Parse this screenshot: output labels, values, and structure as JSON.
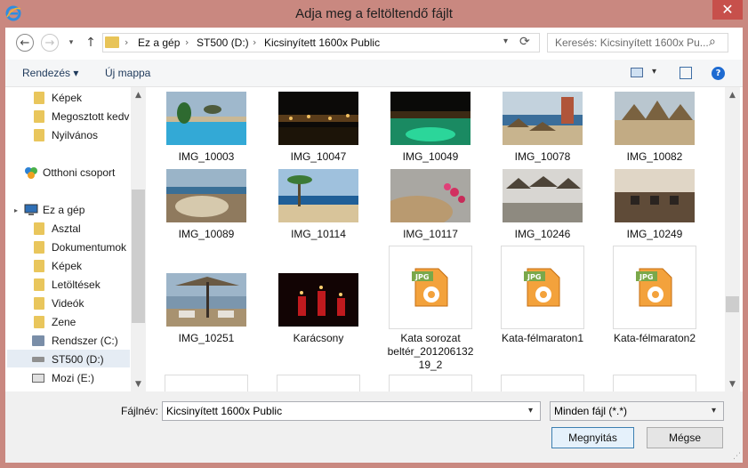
{
  "window": {
    "title": "Adja meg a feltöltendő fájlt",
    "close_glyph": "✕",
    "app_icon": "ie-icon"
  },
  "address": {
    "crumbs": [
      "Ez a gép",
      "ST500 (D:)",
      "Kicsinyített 1600x Public"
    ],
    "separator": "›",
    "search_placeholder": "Keresés: Kicsinyített 1600x Pu..."
  },
  "toolbar": {
    "organize": "Rendezés ▾",
    "new_folder": "Új mappa"
  },
  "nav": {
    "items": [
      {
        "label": "Képek",
        "icon": "folder-icon"
      },
      {
        "label": "Megosztott kedv",
        "icon": "folder-icon"
      },
      {
        "label": "Nyilvános",
        "icon": "folder-icon"
      },
      {
        "label": "Otthoni csoport",
        "icon": "homegroup-icon"
      },
      {
        "label": "Ez a gép",
        "icon": "computer-icon"
      },
      {
        "label": "Asztal",
        "icon": "desktop-folder-icon"
      },
      {
        "label": "Dokumentumok",
        "icon": "documents-folder-icon"
      },
      {
        "label": "Képek",
        "icon": "pictures-folder-icon"
      },
      {
        "label": "Letöltések",
        "icon": "downloads-folder-icon"
      },
      {
        "label": "Videók",
        "icon": "videos-folder-icon"
      },
      {
        "label": "Zene",
        "icon": "music-folder-icon"
      },
      {
        "label": "Rendszer (C:)",
        "icon": "system-drive-icon"
      },
      {
        "label": "ST500 (D:)",
        "icon": "drive-icon"
      },
      {
        "label": "Mozi (E:)",
        "icon": "drive-icon"
      }
    ]
  },
  "files": [
    {
      "name": "IMG_10003"
    },
    {
      "name": "IMG_10047"
    },
    {
      "name": "IMG_10049"
    },
    {
      "name": "IMG_10078"
    },
    {
      "name": "IMG_10082"
    },
    {
      "name": "IMG_10089"
    },
    {
      "name": "IMG_10114"
    },
    {
      "name": "IMG_10117"
    },
    {
      "name": "IMG_10246"
    },
    {
      "name": "IMG_10249"
    },
    {
      "name": "IMG_10251"
    },
    {
      "name": "Karácsony"
    },
    {
      "name": "Kata sorozat beltér_20120613219_2",
      "lines": [
        "Kata sorozat",
        "beltér_201206132",
        "19_2"
      ]
    },
    {
      "name": "Kata-félmaraton1"
    },
    {
      "name": "Kata-félmaraton2"
    }
  ],
  "jpg_badge": "JPG",
  "footer": {
    "filename_label": "Fájlnév:",
    "filename_value": "Kicsinyített 1600x Public",
    "filetype_value": "Minden fájl (*.*)",
    "open_label": "Megnyitás",
    "cancel_label": "Mégse"
  }
}
